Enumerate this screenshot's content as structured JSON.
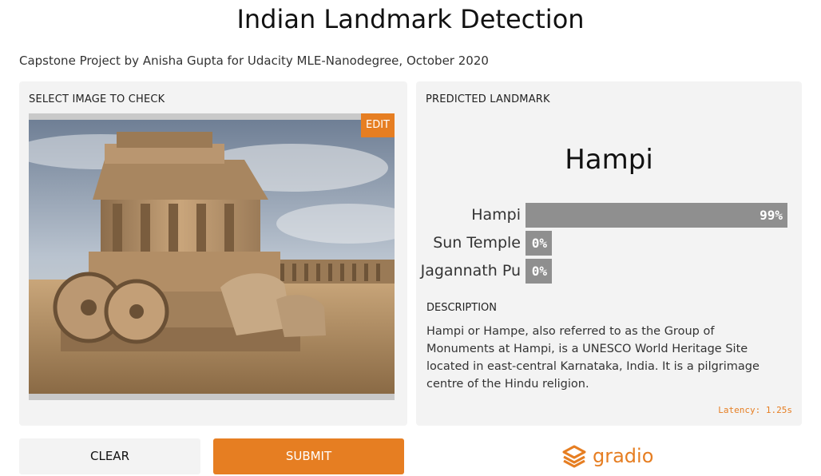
{
  "header": {
    "title": "Indian Landmark Detection",
    "subtitle": "Capstone Project by Anisha Gupta for Udacity MLE-Nanodegree, October 2020"
  },
  "input_panel": {
    "label": "SELECT IMAGE TO CHECK",
    "edit_label": "EDIT"
  },
  "output_panel": {
    "label": "PREDICTED LANDMARK",
    "prediction": "Hampi",
    "confidences": [
      {
        "label": "Hampi",
        "value": 0.99,
        "percent": "99%"
      },
      {
        "label": "Sun Temple",
        "value": 0.0,
        "percent": "0%"
      },
      {
        "label": "Jagannath Pu",
        "value": 0.0,
        "percent": "0%"
      }
    ],
    "description_label": "DESCRIPTION",
    "description": "Hampi or Hampe, also referred to as the Group of Monuments at Hampi, is a UNESCO World Heritage Site located in east-central Karnataka, India. It is a pilgrimage centre of the Hindu religion.",
    "latency": "Latency: 1.25s"
  },
  "buttons": {
    "clear": "CLEAR",
    "submit": "SUBMIT"
  },
  "brand": {
    "name": "gradio",
    "icon": "gradio-logo-icon"
  },
  "colors": {
    "accent": "#e67e22",
    "panel_bg": "#f3f3f3",
    "bar": "#8f8f8f"
  }
}
